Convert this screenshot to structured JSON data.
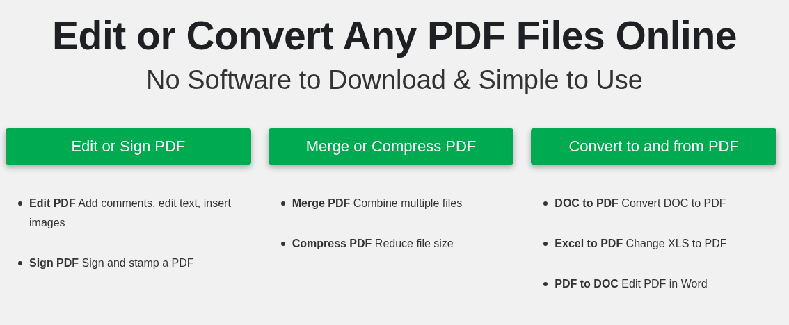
{
  "heading": "Edit or Convert Any PDF Files Online",
  "subheading": "No Software to Download & Simple to Use",
  "columns": [
    {
      "button": "Edit or Sign PDF",
      "items": [
        {
          "title": "Edit PDF",
          "text": "Add comments, edit text, insert images"
        },
        {
          "title": "Sign PDF",
          "text": "Sign and stamp a PDF"
        }
      ]
    },
    {
      "button": "Merge or Compress PDF",
      "items": [
        {
          "title": "Merge PDF",
          "text": "Combine multiple files"
        },
        {
          "title": "Compress PDF",
          "text": "Reduce file size"
        }
      ]
    },
    {
      "button": "Convert to and from PDF",
      "items": [
        {
          "title": "DOC to PDF",
          "text": "Convert DOC to PDF"
        },
        {
          "title": "Excel to PDF",
          "text": "Change XLS to PDF"
        },
        {
          "title": "PDF to DOC",
          "text": "Edit PDF in Word"
        }
      ]
    }
  ]
}
